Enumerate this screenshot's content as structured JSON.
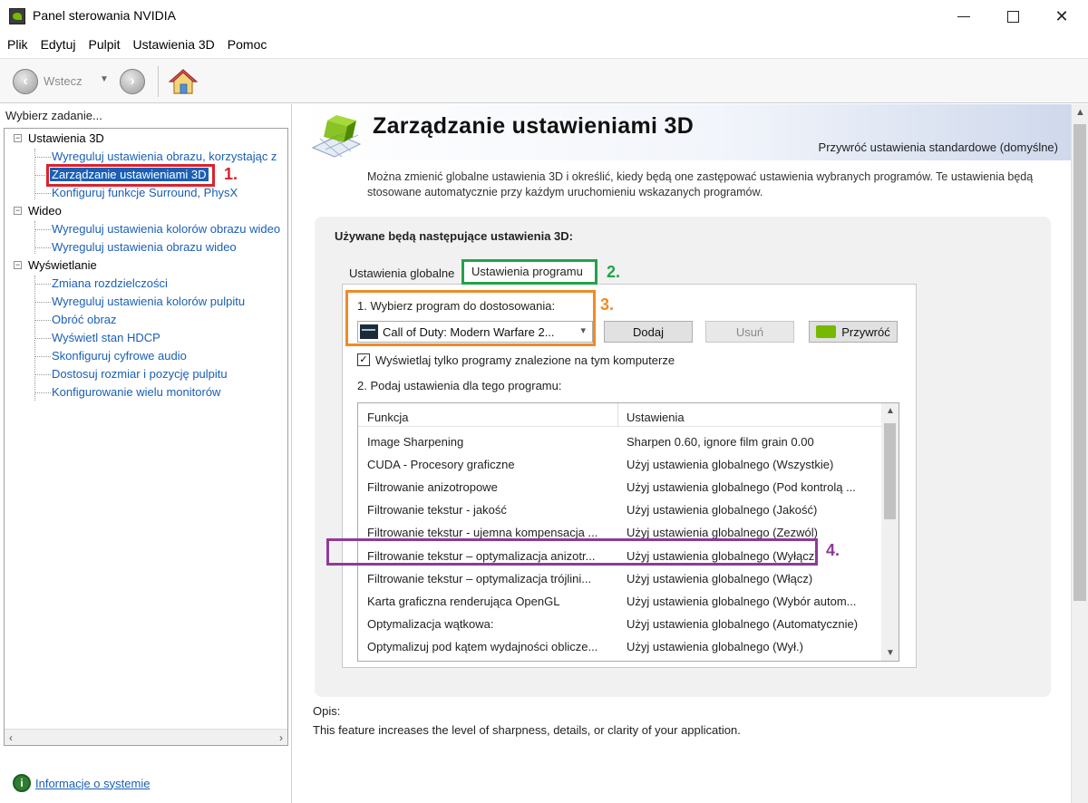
{
  "window": {
    "title": "Panel sterowania NVIDIA"
  },
  "menu": [
    "Plik",
    "Edytuj",
    "Pulpit",
    "Ustawienia 3D",
    "Pomoc"
  ],
  "toolbar": {
    "back_label": "Wstecz",
    "back_icon": "arrow-left-icon",
    "forward_icon": "arrow-right-icon",
    "home_icon": "home-icon"
  },
  "left_pane": {
    "title": "Wybierz zadanie...",
    "categories": [
      {
        "label": "Ustawienia 3D",
        "items": [
          "Wyreguluj ustawienia obrazu, korzystając z",
          "Zarządzanie ustawieniami 3D",
          "Konfiguruj funkcje Surround, PhysX"
        ]
      },
      {
        "label": "Wideo",
        "items": [
          "Wyreguluj ustawienia kolorów obrazu wideo",
          "Wyreguluj ustawienia obrazu wideo"
        ]
      },
      {
        "label": "Wyświetlanie",
        "items": [
          "Zmiana rozdzielczości",
          "Wyreguluj ustawienia kolorów pulpitu",
          "Obróć obraz",
          "Wyświetl stan HDCP",
          "Skonfiguruj cyfrowe audio",
          "Dostosuj rozmiar i pozycję pulpitu",
          "Konfigurowanie wielu monitorów"
        ]
      }
    ],
    "selected_item": "Zarządzanie ustawieniami 3D",
    "system_info_link": "Informacje o systemie"
  },
  "main": {
    "title": "Zarządzanie ustawieniami 3D",
    "restore_defaults": "Przywróć ustawienia standardowe (domyślne)",
    "intro": "Można zmienić globalne ustawienia 3D i określić, kiedy będą one zastępować ustawienia wybranych programów. Te ustawienia będą stosowane automatycznie przy każdym uruchomieniu wskazanych programów.",
    "panel_heading": "Używane będą następujące ustawienia 3D:",
    "tabs": [
      "Ustawienia globalne",
      "Ustawienia programu"
    ],
    "active_tab": "Ustawienia programu",
    "step1_label": "1. Wybierz program do dostosowania:",
    "selected_program": "Call of Duty: Modern Warfare 2...",
    "buttons": {
      "add": "Dodaj",
      "remove": "Usuń",
      "restore": "Przywróć"
    },
    "checkbox_label": "Wyświetlaj tylko programy znalezione na tym komputerze",
    "checkbox_checked": true,
    "step2_label": "2. Podaj ustawienia dla tego programu:",
    "grid": {
      "headers": [
        "Funkcja",
        "Ustawienia"
      ],
      "rows": [
        [
          "Image Sharpening",
          "Sharpen 0.60, ignore film grain 0.00"
        ],
        [
          "CUDA - Procesory graficzne",
          "Użyj ustawienia globalnego (Wszystkie)"
        ],
        [
          "Filtrowanie anizotropowe",
          "Użyj ustawienia globalnego (Pod kontrolą ..."
        ],
        [
          "Filtrowanie tekstur - jakość",
          "Użyj ustawienia globalnego (Jakość)"
        ],
        [
          "Filtrowanie tekstur - ujemna kompensacja ...",
          "Użyj ustawienia globalnego (Zezwól)"
        ],
        [
          "Filtrowanie tekstur – optymalizacja anizotr...",
          "Użyj ustawienia globalnego (Wyłącz)"
        ],
        [
          "Filtrowanie tekstur – optymalizacja trójlini...",
          "Użyj ustawienia globalnego (Włącz)"
        ],
        [
          "Karta graficzna renderująca OpenGL",
          "Użyj ustawienia globalnego (Wybór autom..."
        ],
        [
          "Optymalizacja wątkowa:",
          "Użyj ustawienia globalnego (Automatycznie)"
        ],
        [
          "Optymalizuj pod kątem wydajności oblicze...",
          "Użyj ustawienia globalnego (Wył.)"
        ]
      ]
    },
    "description_label": "Opis:",
    "description_text": "This feature increases the level of sharpness, details, or clarity of your application."
  },
  "annotations": {
    "markers": [
      "1.",
      "2.",
      "3.",
      "4."
    ],
    "colors": {
      "1": "#d9232e",
      "2": "#22a24a",
      "3": "#f08a24",
      "4": "#8e3b96"
    }
  },
  "colors": {
    "link": "#1a5fb4",
    "nvidia_green": "#76b900",
    "selected_bg": "#1a5fb4"
  }
}
